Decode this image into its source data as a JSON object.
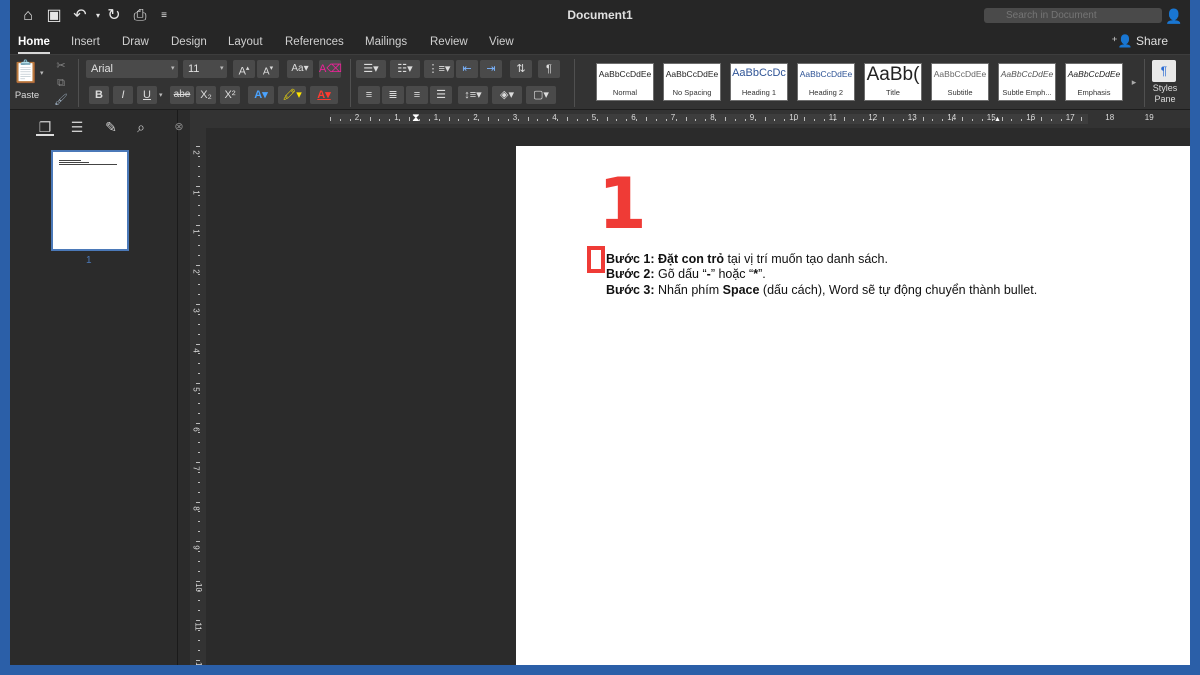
{
  "window": {
    "title": "Document1"
  },
  "search": {
    "placeholder": "Search in Document"
  },
  "tabs": [
    {
      "label": "Home",
      "active": true
    },
    {
      "label": "Insert"
    },
    {
      "label": "Draw"
    },
    {
      "label": "Design"
    },
    {
      "label": "Layout"
    },
    {
      "label": "References"
    },
    {
      "label": "Mailings"
    },
    {
      "label": "Review"
    },
    {
      "label": "View"
    }
  ],
  "share": {
    "label": "Share"
  },
  "ribbon": {
    "paste_label": "Paste",
    "font_name": "Arial",
    "font_size": "11",
    "bold": "B",
    "italic": "I",
    "underline": "U",
    "strikethrough": "abe",
    "subscript": "X₂",
    "superscript": "X²",
    "styles_pane_label": "Styles Pane",
    "styles": [
      {
        "sample": "AaBbCcDdEe",
        "name": "Normal"
      },
      {
        "sample": "AaBbCcDdEe",
        "name": "No Spacing"
      },
      {
        "sample": "AaBbCcDc",
        "name": "Heading 1"
      },
      {
        "sample": "AaBbCcDdEe",
        "name": "Heading 2"
      },
      {
        "sample": "AaBb(",
        "name": "Title"
      },
      {
        "sample": "AaBbCcDdEe",
        "name": "Subtitle"
      },
      {
        "sample": "AaBbCcDdEe",
        "name": "Subtle Emph..."
      },
      {
        "sample": "AaBbCcDdEe",
        "name": "Emphasis"
      }
    ]
  },
  "navpane": {
    "page_number": "1"
  },
  "document": {
    "annotation_number": "1",
    "lines": [
      {
        "label": "Bước 1:",
        "bold": "Đặt con trỏ",
        "rest": " tại vị trí muốn tạo danh sách."
      },
      {
        "label": "Bước 2:",
        "rest": " Gõ dấu “",
        "bold": "-",
        "rest2": "” hoặc “",
        "bold2": "*",
        "rest3": "”."
      },
      {
        "label": "Bước 3:",
        "rest": " Nhấn phím ",
        "bold": "Space",
        "rest2": " (dấu cách), Word sẽ tự động chuyển thành bullet."
      }
    ]
  },
  "ruler": {
    "h_numbers": [
      "2",
      "1",
      "1",
      "2",
      "3",
      "4",
      "5",
      "6",
      "7",
      "8",
      "9",
      "10",
      "11",
      "12",
      "13",
      "14",
      "15",
      "16",
      "17",
      "18",
      "19"
    ],
    "v_numbers": [
      "2",
      "1",
      "1",
      "2",
      "3",
      "4",
      "5",
      "6",
      "7",
      "8",
      "9",
      "10",
      "11",
      "12"
    ]
  },
  "colors": {
    "accent_red": "#ef3b36",
    "selection_blue": "#4b79b8"
  }
}
